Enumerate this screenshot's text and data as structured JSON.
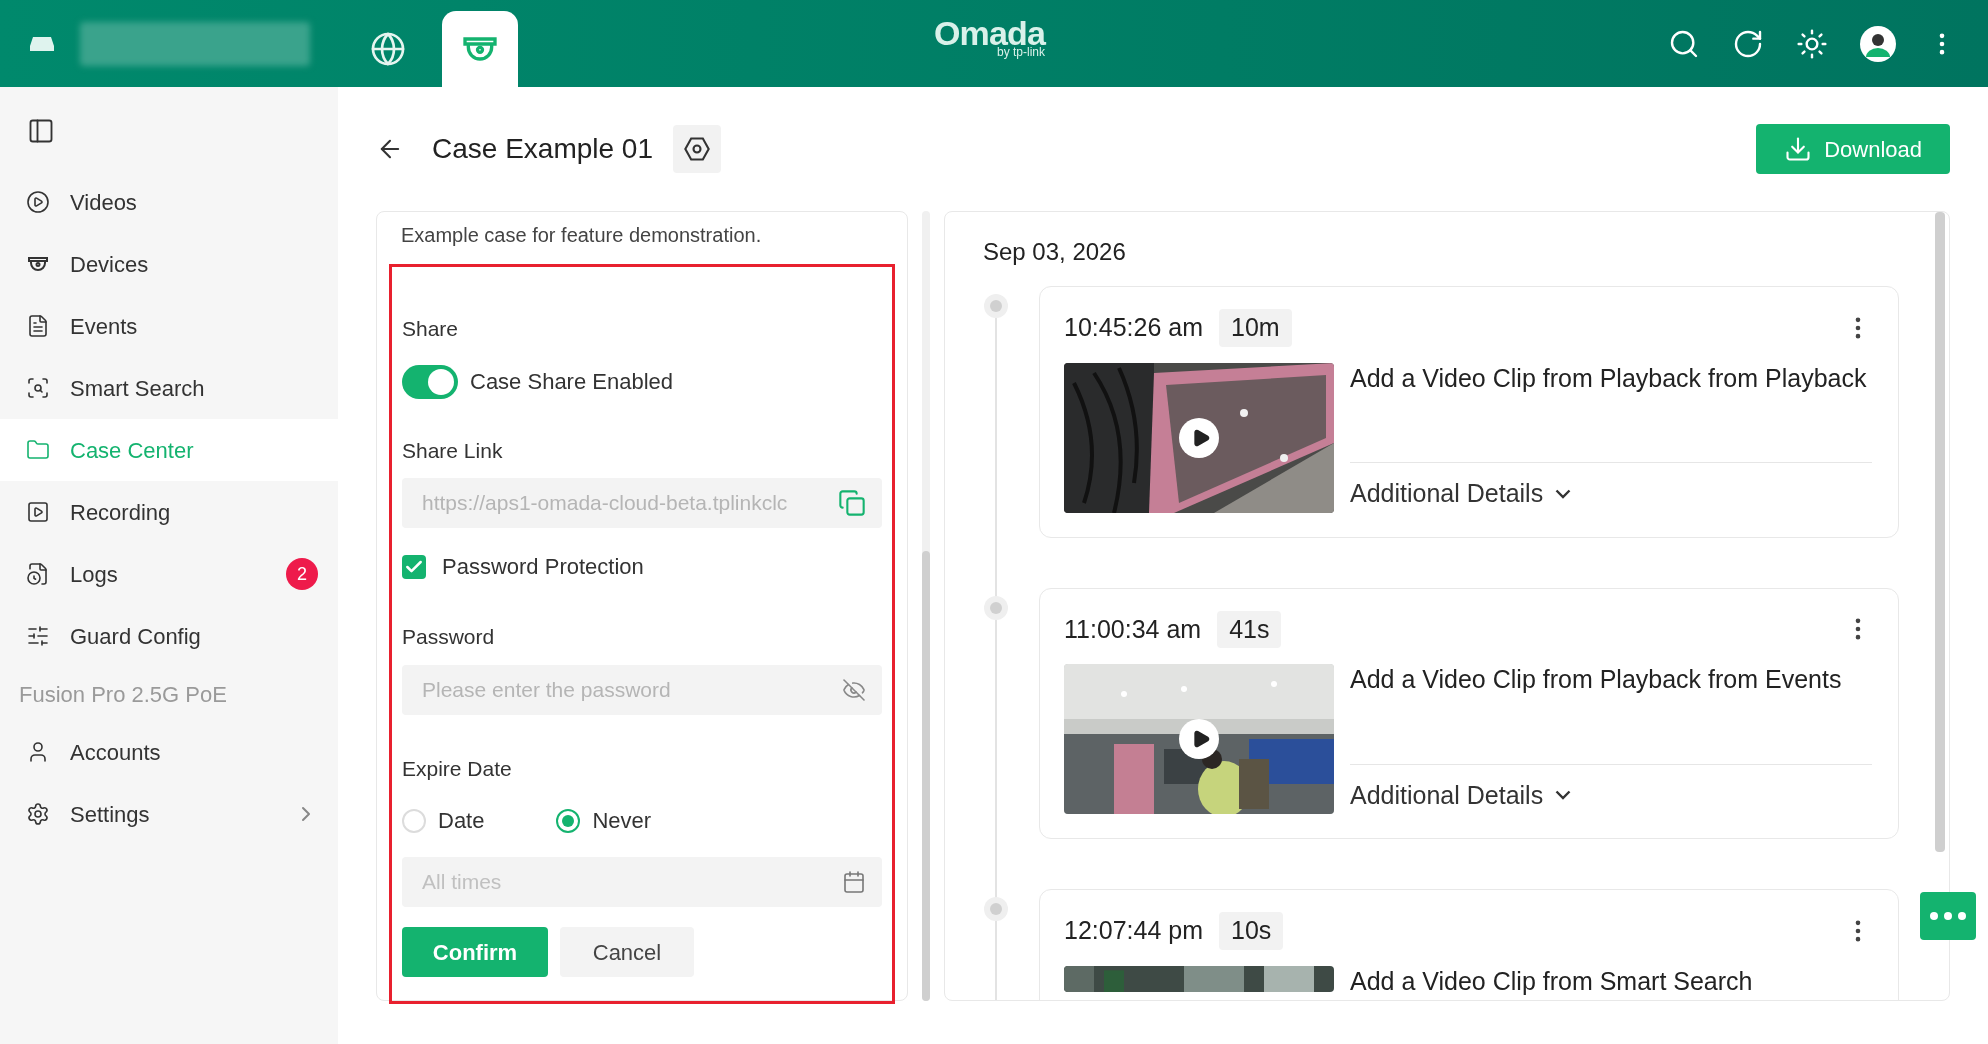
{
  "header": {
    "logo": "Omada",
    "logo_sub": "by tp-link",
    "tabs": [
      {
        "kind": "globe",
        "selected": false
      },
      {
        "kind": "camera",
        "selected": true
      }
    ]
  },
  "sidebar": {
    "items": [
      {
        "kind": "item",
        "label": "Videos",
        "selected": false
      },
      {
        "kind": "item",
        "label": "Devices",
        "selected": false
      },
      {
        "kind": "item",
        "label": "Events",
        "selected": false
      },
      {
        "kind": "item",
        "label": "Smart Search",
        "selected": false
      },
      {
        "kind": "item",
        "label": "Case Center",
        "selected": true
      },
      {
        "kind": "item",
        "label": "Recording",
        "selected": false
      },
      {
        "kind": "item",
        "label": "Logs",
        "selected": false,
        "badge": "2"
      },
      {
        "kind": "item",
        "label": "Guard Config",
        "selected": false
      },
      {
        "kind": "section",
        "label": "Fusion Pro 2.5G PoE"
      },
      {
        "kind": "item",
        "label": "Accounts",
        "selected": false
      },
      {
        "kind": "item",
        "label": "Settings",
        "selected": false,
        "expandable": true
      }
    ]
  },
  "page": {
    "title": "Case Example 01",
    "download": "Download"
  },
  "share_form": {
    "description": "Example case for feature demonstration.",
    "share_label": "Share",
    "share_toggle": {
      "label": "Case Share Enabled",
      "on": true
    },
    "link_label": "Share Link",
    "link_value": "https://aps1-omada-cloud-beta.tplinkclc",
    "password_protection": {
      "label": "Password Protection",
      "checked": true
    },
    "password_label": "Password",
    "password_placeholder": "Please enter the password",
    "expire_label": "Expire Date",
    "expire_options": [
      {
        "label": "Date",
        "selected": false
      },
      {
        "label": "Never",
        "selected": true
      }
    ],
    "time_placeholder": "All times",
    "confirm": "Confirm",
    "cancel": "Cancel"
  },
  "timeline": {
    "date": "Sep 03, 2026",
    "entries": [
      {
        "time": "10:45:26 am",
        "duration": "10m",
        "title": "Add a Video Clip from Playback from Playback",
        "details": "Additional Details"
      },
      {
        "time": "11:00:34 am",
        "duration": "41s",
        "title": "Add a Video Clip from Playback from Events",
        "details": "Additional Details"
      },
      {
        "time": "12:07:44 pm",
        "duration": "10s",
        "title": "Add a Video Clip from Smart Search"
      }
    ]
  }
}
